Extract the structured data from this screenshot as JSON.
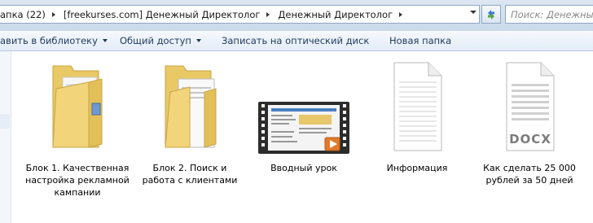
{
  "address": {
    "crumbs": [
      "апка (22)",
      "[freekurses.com] Денежный Директолог",
      "Денежный Директолог"
    ],
    "search_placeholder": "Поиск: Денежный"
  },
  "toolbar": {
    "library_label": "авить в библиотеку",
    "share_label": "Общий доступ",
    "burn_label": "Записать на оптический диск",
    "new_folder_label": "Новая папка"
  },
  "items": [
    {
      "name": "Блок 1. Качественная настройка рекламной кампании",
      "type": "folder",
      "icon": "folder-icon"
    },
    {
      "name": "Блок 2. Поиск и работа с клиентами",
      "type": "folder",
      "icon": "folder-icon"
    },
    {
      "name": "Вводный урок",
      "type": "video",
      "icon": "video-thumbnail-icon"
    },
    {
      "name": "Информация",
      "type": "text",
      "icon": "text-file-icon"
    },
    {
      "name": "Как сделать 25 000 рублей за 50 дней",
      "type": "docx",
      "icon": "docx-file-icon",
      "badge": "DOCX"
    }
  ]
}
